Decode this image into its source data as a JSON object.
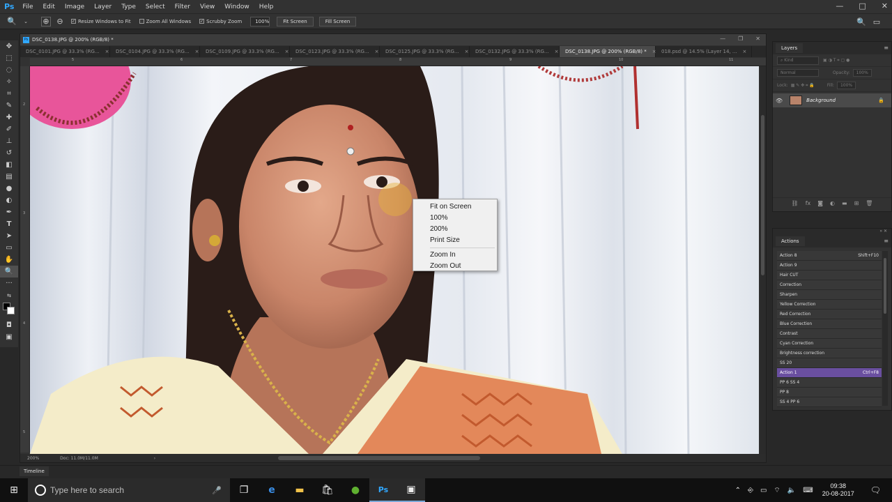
{
  "app": {
    "logo": "Ps",
    "menu": [
      "File",
      "Edit",
      "Image",
      "Layer",
      "Type",
      "Select",
      "Filter",
      "View",
      "Window",
      "Help"
    ],
    "win_controls": [
      "—",
      "□",
      "✕"
    ]
  },
  "options_bar": {
    "resize_windows_label": "Resize Windows to Fit",
    "resize_windows_checked": true,
    "zoom_all_windows_label": "Zoom All Windows",
    "zoom_all_windows_checked": false,
    "scrubby_zoom_label": "Scrubby Zoom",
    "scrubby_zoom_checked": true,
    "zoom_value": "100%",
    "fit_screen_label": "Fit Screen",
    "fill_screen_label": "Fill Screen"
  },
  "document": {
    "title": "DSC_0138.JPG @ 200% (RGB/8) *",
    "tabs": [
      {
        "label": "DSC_0101.JPG @ 33.3% (RG...",
        "active": false
      },
      {
        "label": "DSC_0104.JPG @ 33.3% (RG...",
        "active": false
      },
      {
        "label": "DSC_0109.JPG @ 33.3% (RG...",
        "active": false
      },
      {
        "label": "DSC_0123.JPG @ 33.3% (RG...",
        "active": false
      },
      {
        "label": "DSC_0125.JPG @ 33.3% (RG...",
        "active": false
      },
      {
        "label": "DSC_0132.JPG @ 33.3% (RG...",
        "active": false
      },
      {
        "label": "DSC_0138.JPG @ 200% (RGB/8) *",
        "active": true
      },
      {
        "label": "018.psd @ 14.5% (Layer 14, ...",
        "active": false
      }
    ],
    "ruler_h": [
      "5",
      "6",
      "7",
      "8",
      "9",
      "10",
      "11"
    ],
    "ruler_v": [
      "2",
      "3",
      "4",
      "5"
    ],
    "status_zoom": "200%",
    "status_doc": "Doc: 11.0M/11.0M"
  },
  "context_menu": {
    "items": [
      "Fit on Screen",
      "100%",
      "200%",
      "Print Size"
    ],
    "items2": [
      "Zoom In",
      "Zoom Out"
    ]
  },
  "layers_panel": {
    "tab": "Layers",
    "kind_placeholder": "Kind",
    "blend_mode": "Normal",
    "opacity_label": "Opacity:",
    "opacity_value": "100%",
    "lock_label": "Lock:",
    "fill_label": "Fill:",
    "fill_value": "100%",
    "layer_name": "Background"
  },
  "actions_panel": {
    "tab": "Actions",
    "items": [
      {
        "name": "Action 8",
        "shortcut": "Shift+F10",
        "selected": false
      },
      {
        "name": "Action 9",
        "shortcut": "",
        "selected": false
      },
      {
        "name": "Hair CUT",
        "shortcut": "",
        "selected": false
      },
      {
        "name": "Correction",
        "shortcut": "",
        "selected": false
      },
      {
        "name": "Sharpen",
        "shortcut": "",
        "selected": false
      },
      {
        "name": "Yellow Correction",
        "shortcut": "",
        "selected": false
      },
      {
        "name": "Red Correction",
        "shortcut": "",
        "selected": false
      },
      {
        "name": "Blue Correction",
        "shortcut": "",
        "selected": false
      },
      {
        "name": "Contrast",
        "shortcut": "",
        "selected": false
      },
      {
        "name": "Cyan Correction",
        "shortcut": "",
        "selected": false
      },
      {
        "name": "Brightness correction",
        "shortcut": "",
        "selected": false
      },
      {
        "name": "SS 20",
        "shortcut": "",
        "selected": false
      },
      {
        "name": "Action 1",
        "shortcut": "Ctrl+F8",
        "selected": true
      },
      {
        "name": "PP 6 SS 4",
        "shortcut": "",
        "selected": false
      },
      {
        "name": "PP 8",
        "shortcut": "",
        "selected": false
      },
      {
        "name": "SS 4 PP 6",
        "shortcut": "",
        "selected": false
      }
    ]
  },
  "timeline": {
    "tab": "Timeline"
  },
  "taskbar": {
    "search_placeholder": "Type here to search",
    "time": "09:38",
    "date": "20-08-2017"
  }
}
